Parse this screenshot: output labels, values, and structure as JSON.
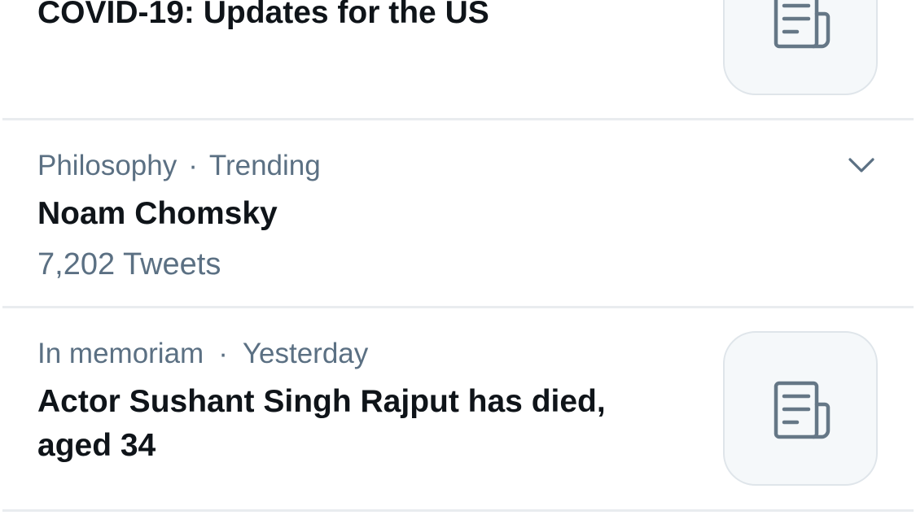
{
  "trends": [
    {
      "title": "COVID-19: Updates for the US",
      "thumbnail_icon": "news-article-icon"
    },
    {
      "category": "Philosophy",
      "separator": "·",
      "status": "Trending",
      "title": "Noam Chomsky",
      "tweet_count": "7,202 Tweets",
      "menu_icon": "chevron-down-icon"
    },
    {
      "category": "In memoriam",
      "separator": "·",
      "status": "Yesterday",
      "title_line1": "Actor Sushant Singh Rajput has died,",
      "title_line2": "aged 34",
      "thumbnail_icon": "news-article-icon"
    }
  ],
  "colors": {
    "primary_text": "#0f1419",
    "secondary_text": "#5b7083",
    "divider": "#e9ecef",
    "thumb_bg": "#f5f8fa",
    "thumb_border": "#dfe5ea",
    "icon": "#657786"
  }
}
